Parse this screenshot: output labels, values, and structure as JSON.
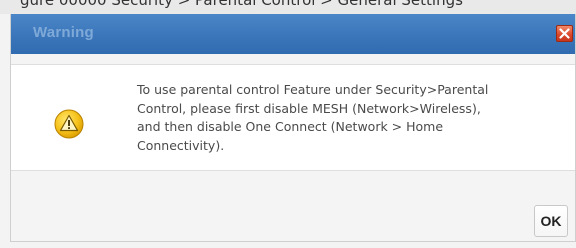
{
  "background": {
    "partial_text": "gure 00000 Security > Parental Control > General Settings"
  },
  "dialog": {
    "title": "Warning",
    "close_icon": "close-icon",
    "icon": "warning-icon",
    "message_lines": [
      "To use parental control Feature under Security>Parental",
      "Control, please first disable MESH (Network>Wireless),",
      "and then disable One Connect (Network > Home",
      "Connectivity)."
    ],
    "ok_label": "OK"
  },
  "colors": {
    "titlebar": "#3b76ba",
    "title_text": "#7fa9d8",
    "close_button": "#d9452a",
    "warning_icon": "#f2b705"
  }
}
